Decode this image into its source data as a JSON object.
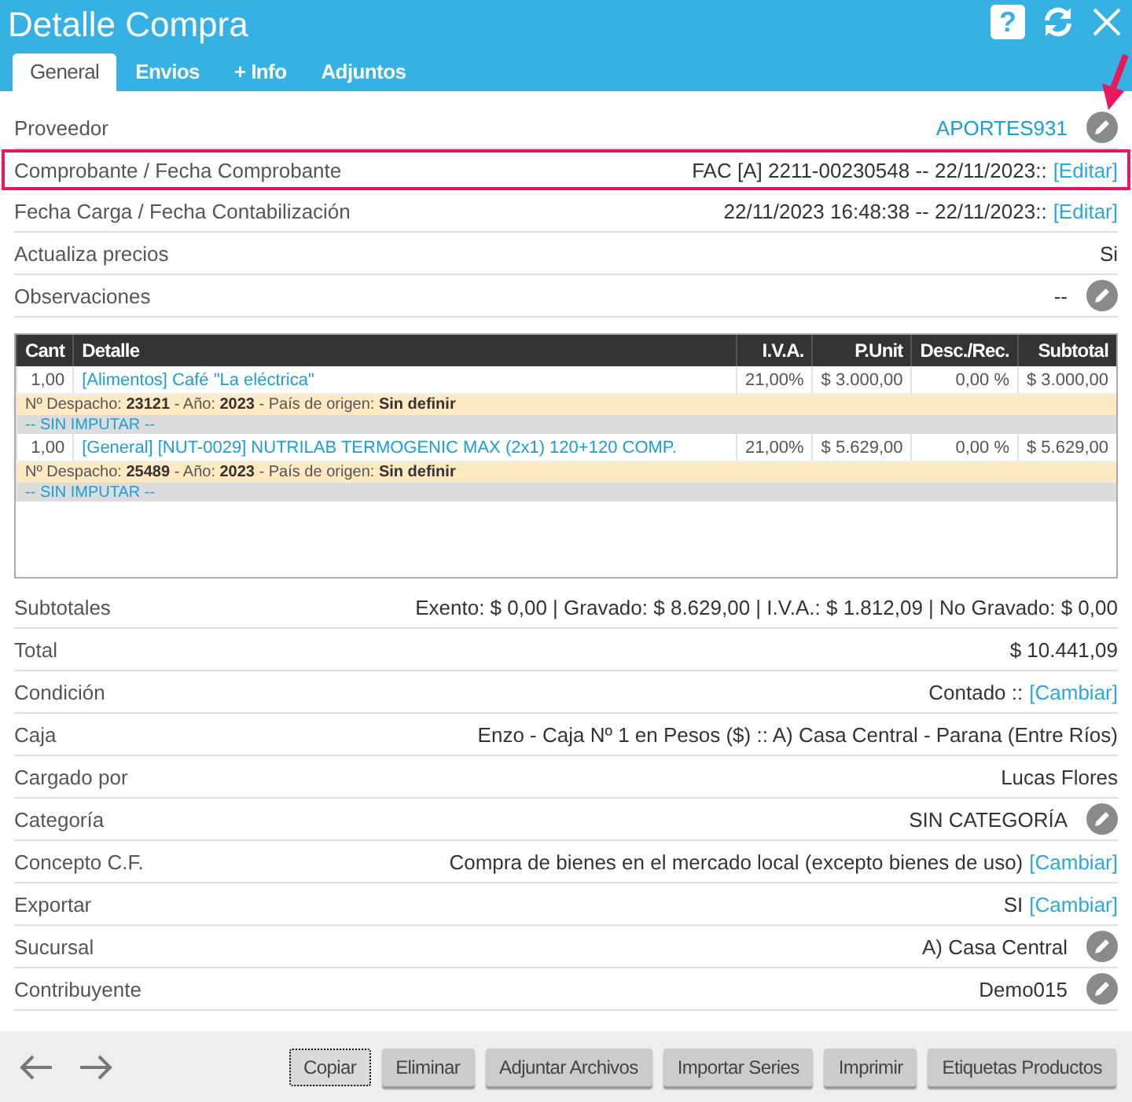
{
  "window": {
    "title": "Detalle Compra",
    "help": "?"
  },
  "tabs": [
    {
      "label": "General",
      "selected": true
    },
    {
      "label": "Envios",
      "selected": false
    },
    {
      "label": "+ Info",
      "selected": false
    },
    {
      "label": "Adjuntos",
      "selected": false
    }
  ],
  "header_fields": [
    {
      "label": "Proveedor",
      "value": "APORTES931",
      "kind": "link",
      "edit": true,
      "highlighted": false
    },
    {
      "label": "Comprobante / Fecha Comprobante",
      "value": "FAC [A] 2211-00230548 -- 22/11/2023::",
      "action": "[Editar]",
      "kind": "text",
      "edit": false,
      "highlighted": true
    },
    {
      "label": "Fecha Carga / Fecha Contabilización",
      "value": "22/11/2023 16:48:38 -- 22/11/2023::",
      "action": "[Editar]",
      "kind": "text",
      "edit": false,
      "highlighted": false
    },
    {
      "label": "Actualiza precios",
      "value": "Si",
      "kind": "text",
      "edit": false,
      "highlighted": false
    },
    {
      "label": "Observaciones",
      "value": "--",
      "kind": "text",
      "edit": true,
      "highlighted": false
    }
  ],
  "items_table": {
    "columns": [
      "Cant",
      "Detalle",
      "I.V.A.",
      "P.Unit",
      "Desc./Rec.",
      "Subtotal"
    ],
    "rows": [
      {
        "cant": "1,00",
        "detalle": "[Alimentos] Café \"La eléctrica\"",
        "iva": "21,00%",
        "punit": "$ 3.000,00",
        "desc": "0,00 %",
        "subtotal": "$ 3.000,00",
        "despacho": "Nº Despacho: **23121** - Año: **2023** - País de origen: **Sin definir**",
        "imputacion": "-- SIN IMPUTAR --"
      },
      {
        "cant": "1,00",
        "detalle": "[General] [NUT-0029] NUTRILAB TERMOGENIC MAX (2x1) 120+120 COMP.",
        "iva": "21,00%",
        "punit": "$ 5.629,00",
        "desc": "0,00 %",
        "subtotal": "$ 5.629,00",
        "despacho": "Nº Despacho: **25489** - Año: **2023** - País de origen: **Sin definir**",
        "imputacion": "-- SIN IMPUTAR --"
      }
    ]
  },
  "summary_fields": [
    {
      "label": "Subtotales",
      "value": "Exento: $ 0,00 | Gravado: $ 8.629,00 | I.V.A.: $ 1.812,09 | No Gravado: $ 0,00",
      "edit": false
    },
    {
      "label": "Total",
      "value": "$ 10.441,09",
      "edit": false
    },
    {
      "label": "Condición",
      "value": "Contado ::",
      "action": "[Cambiar]",
      "edit": false
    },
    {
      "label": "Caja",
      "value": "Enzo - Caja Nº 1 en Pesos ($) :: A) Casa Central - Parana (Entre Ríos)",
      "edit": false
    },
    {
      "label": "Cargado por",
      "value": "Lucas Flores",
      "edit": false
    },
    {
      "label": "Categoría",
      "value": "SIN CATEGORÍA",
      "edit": true
    },
    {
      "label": "Concepto C.F.",
      "value": "Compra de bienes en el mercado local (excepto bienes de uso)",
      "action": "[Cambiar]",
      "edit": false
    },
    {
      "label": "Exportar",
      "value": "SI",
      "action": "[Cambiar]",
      "edit": false
    },
    {
      "label": "Sucursal",
      "value": "A) Casa Central",
      "edit": true
    },
    {
      "label": "Contribuyente",
      "value": "Demo015",
      "edit": true
    }
  ],
  "footer_buttons": [
    {
      "label": "Copiar",
      "focused": true
    },
    {
      "label": "Eliminar",
      "focused": false
    },
    {
      "label": "Adjuntar Archivos",
      "focused": false
    },
    {
      "label": "Importar Series",
      "focused": false
    },
    {
      "label": "Imprimir",
      "focused": false
    },
    {
      "label": "Etiquetas Productos",
      "focused": false
    }
  ]
}
